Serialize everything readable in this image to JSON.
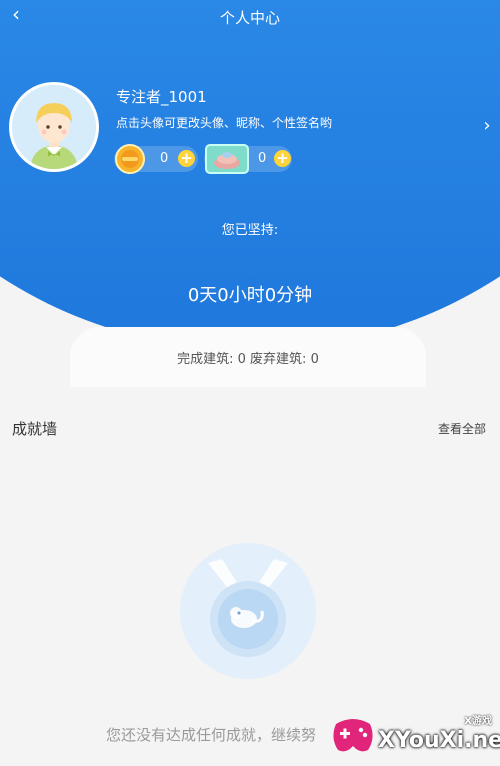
{
  "header": {
    "title": "个人中心",
    "back_icon": "chevron-left-icon"
  },
  "profile": {
    "username": "专注者_1001",
    "hint": "点击头像可更改头像、昵称、个性签名哟",
    "chevron_icon": "chevron-right-icon",
    "coin_count": "0",
    "gift_count": "0"
  },
  "persist": {
    "label": "您已坚持:",
    "time": "0天0小时0分钟"
  },
  "stats": {
    "text": "完成建筑: 0 废弃建筑: 0"
  },
  "achievements": {
    "title": "成就墙",
    "view_all": "查看全部",
    "empty_text": "您还没有达成任何成就，继续努"
  },
  "watermark": {
    "brand": "XYouXi.net",
    "small": "X游戏"
  },
  "colors": {
    "header_blue": "#2a88e6",
    "coin_gold": "#f7b32b",
    "plus_yellow": "#ffd43a",
    "page_bg": "#f4f4f4"
  }
}
